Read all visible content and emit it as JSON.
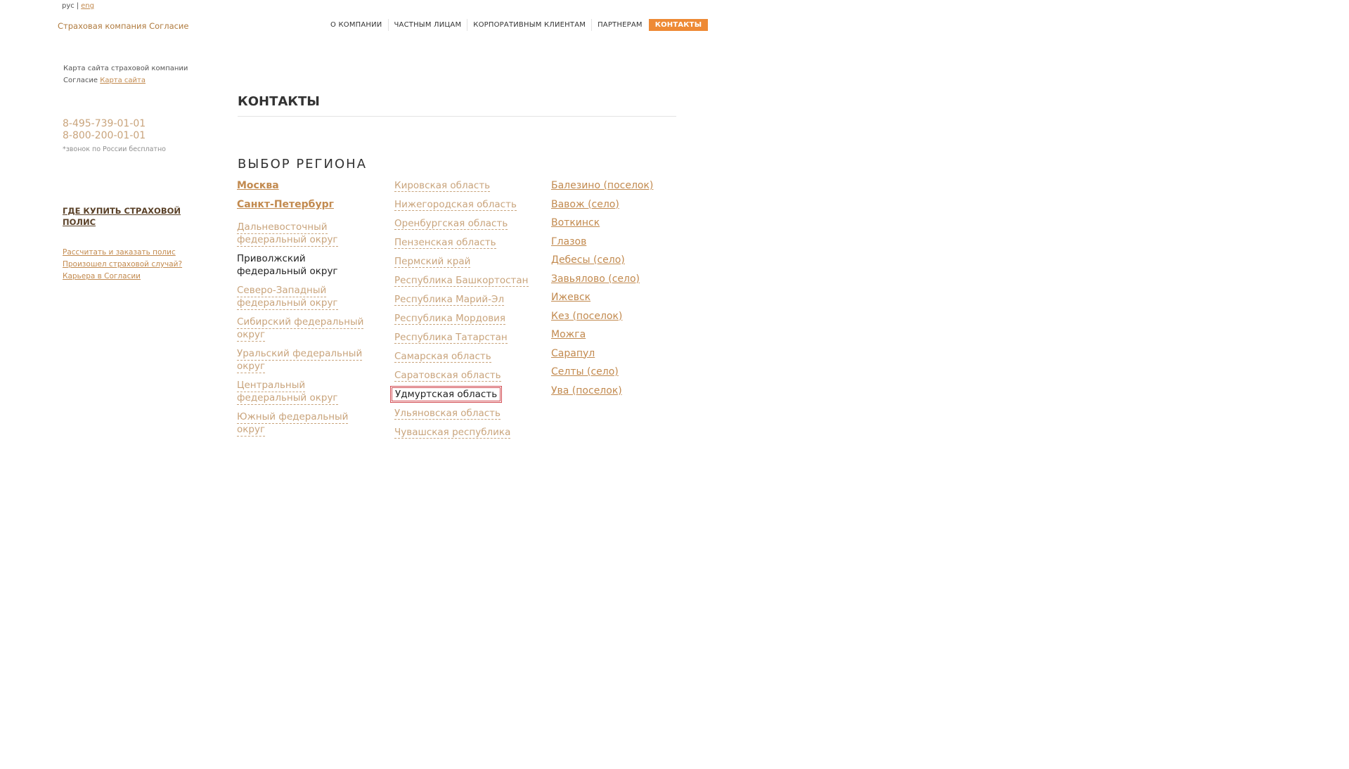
{
  "lang": {
    "ru": "рус",
    "separator": "|",
    "en": "eng"
  },
  "logo": {
    "text": "Страховая компания Согласие"
  },
  "nav": {
    "items": [
      "О КОМПАНИИ",
      "ЧАСТНЫМ ЛИЦАМ",
      "КОРПОРАТИВНЫМ КЛИЕНТАМ",
      "ПАРТНЕРАМ",
      "КОНТАКТЫ"
    ],
    "active": "КОНТАКТЫ",
    "active_color": "#ee8a35"
  },
  "sidebar": {
    "sitemap_text": "Карта сайта страховой компании Согласие",
    "sitemap_link": "Карта сайта",
    "phones": [
      "8-495-739-01-01",
      "8-800-200-01-01"
    ],
    "phone_note": "*звонок по России бесплатно",
    "buy_link": "ГДЕ КУПИТЬ СТРАХОВОЙ ПОЛИС",
    "links": [
      "Рассчитать и заказать полис",
      "Произошел страховой случай?",
      "Карьера в Согласии"
    ]
  },
  "main": {
    "title": "КОНТАКТЫ",
    "region_title": "ВЫБОР РЕГИОНА",
    "cities": [
      "Москва",
      "Санкт-Петербург"
    ],
    "districts": [
      [
        "Дальневосточный",
        "федеральный округ"
      ],
      [
        "Приволжский",
        "федеральный округ"
      ],
      [
        "Северо-Западный",
        "федеральный округ"
      ],
      [
        "Сибирский федеральный",
        "округ"
      ],
      [
        "Уральский федеральный",
        "округ"
      ],
      [
        "Центральный",
        "федеральный округ"
      ],
      [
        "Южный федеральный",
        "округ"
      ]
    ],
    "selected_district": "Приволжский",
    "regions": [
      "Кировская область",
      "Нижегородская область",
      "Оренбургская область",
      "Пензенская область",
      "Пермский край",
      "Республика Башкортостан",
      "Республика Марий-Эл",
      "Республика Мордовия",
      "Республика Татарстан",
      "Самарская область",
      "Саратовская область",
      "Удмуртская область",
      "Ульяновская область",
      "Чувашская республика"
    ],
    "selected_region": "Удмуртская область",
    "region_cities": [
      "Балезино (поселок)",
      "Вавож (село)",
      "Воткинск",
      "Глазов",
      "Дебесы (село)",
      "Завьялово (село)",
      "Ижевск",
      "Кез (поселок)",
      "Можга",
      "Сарапул",
      "Селты (село)",
      "Ува (поселок)"
    ]
  },
  "colors": {
    "link": "#c28a4f",
    "light_link": "#c9a47c",
    "selection_border": "#d24b52"
  }
}
